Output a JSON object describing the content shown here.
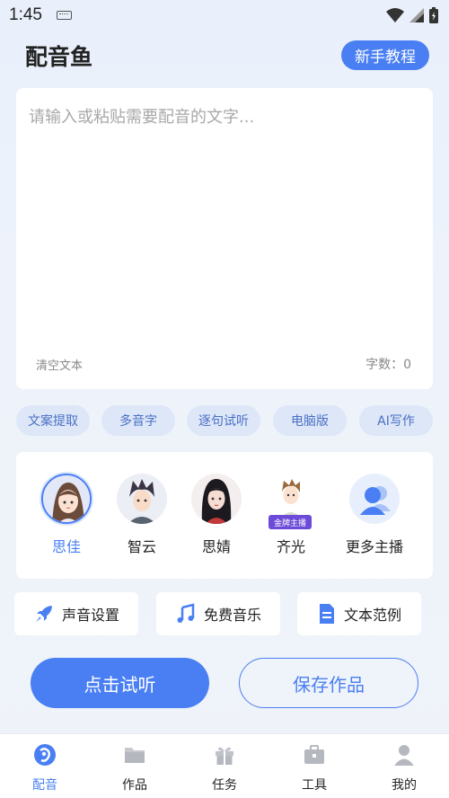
{
  "status_bar": {
    "time": "1:45"
  },
  "header": {
    "title": "配音鱼",
    "tutorial_label": "新手教程"
  },
  "editor": {
    "placeholder": "请输入或粘贴需要配音的文字...",
    "clear_label": "清空文本",
    "count_label": "字数：0"
  },
  "tools": [
    {
      "label": "文案提取"
    },
    {
      "label": "多音字"
    },
    {
      "label": "逐句试听"
    },
    {
      "label": "电脑版"
    },
    {
      "label": "AI写作"
    }
  ],
  "voices": [
    {
      "name": "思佳",
      "selected": true
    },
    {
      "name": "智云"
    },
    {
      "name": "思婧"
    },
    {
      "name": "齐光",
      "badge": "金牌主播"
    },
    {
      "name": "更多主播"
    }
  ],
  "features": [
    {
      "label": "声音设置",
      "icon": "rocket-icon"
    },
    {
      "label": "免费音乐",
      "icon": "music-note-icon"
    },
    {
      "label": "文本范例",
      "icon": "document-icon"
    }
  ],
  "actions": {
    "listen_label": "点击试听",
    "save_label": "保存作品"
  },
  "nav": [
    {
      "label": "配音",
      "icon": "dub-icon",
      "active": true
    },
    {
      "label": "作品",
      "icon": "folder-icon"
    },
    {
      "label": "任务",
      "icon": "gift-icon"
    },
    {
      "label": "工具",
      "icon": "toolbox-icon"
    },
    {
      "label": "我的",
      "icon": "profile-icon"
    }
  ],
  "colors": {
    "accent": "#4a7ff3",
    "chip_bg": "#dde7f8",
    "badge": "#6c4bd8"
  }
}
